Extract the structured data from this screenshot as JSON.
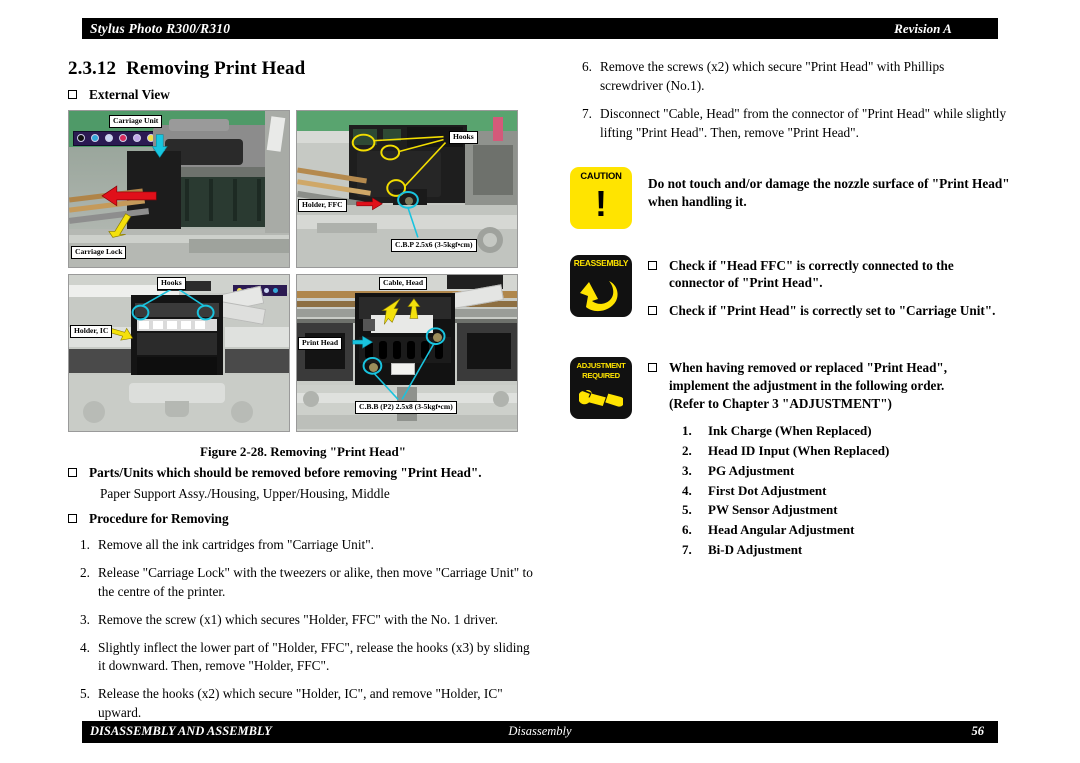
{
  "header": {
    "document_title": "Stylus Photo R300/R310",
    "revision": "Revision A"
  },
  "footer": {
    "left": "DISASSEMBLY AND ASSEMBLY",
    "center": "Disassembly",
    "page_number": "56"
  },
  "section": {
    "number": "2.3.12",
    "title": "Removing Print Head",
    "external_view_label": "External View"
  },
  "figure": {
    "caption": "Figure 2-28.  Removing \"Print Head\"",
    "photos": [
      {
        "id": "photo-carriage-unit",
        "callouts": [
          {
            "text": "Carriage Unit",
            "marker": "cyan-arrow"
          },
          {
            "text": "Carriage Lock",
            "marker": "yellow-arrow"
          }
        ],
        "extra_markers": [
          "red-arrow"
        ]
      },
      {
        "id": "photo-holder-ffc",
        "callouts": [
          {
            "text": "Hooks",
            "marker": "yellow-circles"
          },
          {
            "text": "Holder, FFC",
            "marker": "red-arrow"
          },
          {
            "text": "C.B.P 2.5x6 (3-5kgf•cm)",
            "marker": "cyan-circle"
          }
        ]
      },
      {
        "id": "photo-holder-ic",
        "callouts": [
          {
            "text": "Hooks",
            "marker": "cyan-circles"
          },
          {
            "text": "Holder, IC",
            "marker": "yellow-arrow"
          }
        ]
      },
      {
        "id": "photo-print-head",
        "callouts": [
          {
            "text": "Cable, Head",
            "marker": "yellow-arrows"
          },
          {
            "text": "Print Head",
            "marker": "cyan-arrow"
          },
          {
            "text": "C.B.B (P2) 2.5x8 (3-5kgf•cm)",
            "marker": "cyan-circles"
          }
        ]
      }
    ]
  },
  "parts_units": {
    "heading": "Parts/Units which should be removed before removing \"Print Head\".",
    "list": "Paper Support Assy./Housing, Upper/Housing, Middle"
  },
  "procedure": {
    "heading": "Procedure for Removing",
    "steps": [
      {
        "n": "1.",
        "text": "Remove all the ink cartridges from \"Carriage Unit\"."
      },
      {
        "n": "2.",
        "text": "Release \"Carriage Lock\" with the tweezers or alike, then move \"Carriage Unit\" to the centre of the printer."
      },
      {
        "n": "3.",
        "text": "Remove the screw (x1) which secures \"Holder, FFC\" with the No. 1 driver."
      },
      {
        "n": "4.",
        "text": "Slightly inflect the lower part of \"Holder, FFC\", release the hooks (x3) by sliding it downward. Then, remove \"Holder, FFC\"."
      },
      {
        "n": "5.",
        "text": "Release the hooks (x2) which secure \"Holder, IC\", and remove \"Holder, IC\" upward."
      },
      {
        "n": "6.",
        "text": "Remove the screws (x2) which secure \"Print Head\" with Phillips screwdriver (No.1)."
      },
      {
        "n": "7.",
        "text": "Disconnect \"Cable, Head\" from the connector of \"Print Head\" while slightly lifting \"Print Head\". Then, remove \"Print Head\"."
      }
    ]
  },
  "caution": {
    "icon_label": "CAUTION",
    "icon_glyph": "!",
    "text": "Do not touch and/or damage the nozzle surface of \"Print Head\" when handling it.",
    "color": "#ffe400"
  },
  "reassembly": {
    "icon_label": "REASSEMBLY",
    "icon_name": "curved-arrow-icon",
    "color": "#ffe400",
    "background": "#111111",
    "items": [
      "Check if \"Head FFC\" is correctly connected to the connector of \"Print Head\".",
      "Check if \"Print Head\" is correctly set to \"Carriage Unit\"."
    ]
  },
  "adjustment": {
    "icon_label_line1": "ADJUSTMENT",
    "icon_label_line2": "REQUIRED",
    "icon_name": "wrench-icon",
    "color": "#ffe400",
    "background": "#111111",
    "heading": "When having removed or replaced \"Print Head\", implement the adjustment in the following order.",
    "reference": "(Refer to Chapter 3 \"ADJUSTMENT\")",
    "items": [
      {
        "n": "1.",
        "text": "Ink Charge (When Replaced)"
      },
      {
        "n": "2.",
        "text": "Head ID Input (When Replaced)"
      },
      {
        "n": "3.",
        "text": "PG Adjustment"
      },
      {
        "n": "4.",
        "text": "First Dot Adjustment"
      },
      {
        "n": "5.",
        "text": "PW Sensor Adjustment"
      },
      {
        "n": "6.",
        "text": "Head Angular Adjustment"
      },
      {
        "n": "7.",
        "text": "Bi-D Adjustment"
      }
    ]
  }
}
